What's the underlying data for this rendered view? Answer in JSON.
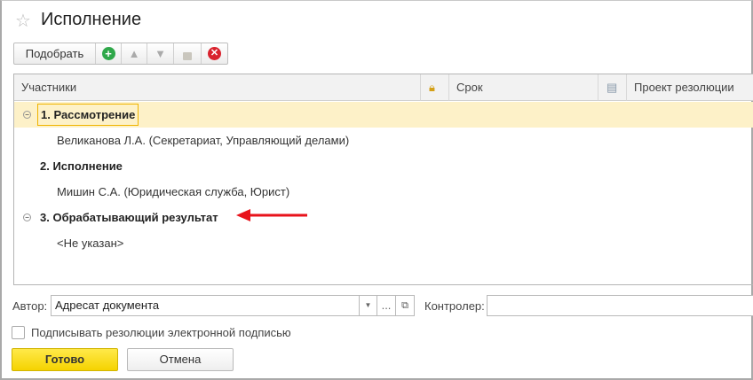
{
  "window": {
    "title": "Исполнение"
  },
  "toolbar": {
    "pick_label": "Подобрать"
  },
  "table": {
    "columns": [
      "Участники",
      "Срок",
      "Проект резолюции"
    ],
    "rows": [
      {
        "type": "group",
        "label": "1. Рассмотрение",
        "selected": true
      },
      {
        "type": "item",
        "label": "Великанова Л.А. (Секретариат, Управляющий делами)"
      },
      {
        "type": "group",
        "label": "2. Исполнение"
      },
      {
        "type": "item",
        "label": "Мишин С.А. (Юридическая служба, Юрист)"
      },
      {
        "type": "group",
        "label": "3. Обрабатывающий результат"
      },
      {
        "type": "item",
        "label": "<Не указан>"
      }
    ]
  },
  "form": {
    "author_label": "Автор:",
    "author_value": "Адресат документа",
    "dots": "...",
    "controller_label": "Контролер:",
    "controller_value": "",
    "sign_checkbox_label": "Подписывать резолюции электронной подписью",
    "sign_checked": false
  },
  "buttons": {
    "ok": "Готово",
    "cancel": "Отмена"
  },
  "colors": {
    "selected_row": "#fdf1c8",
    "accent": "#f5d800",
    "arrow": "#e8131b"
  }
}
